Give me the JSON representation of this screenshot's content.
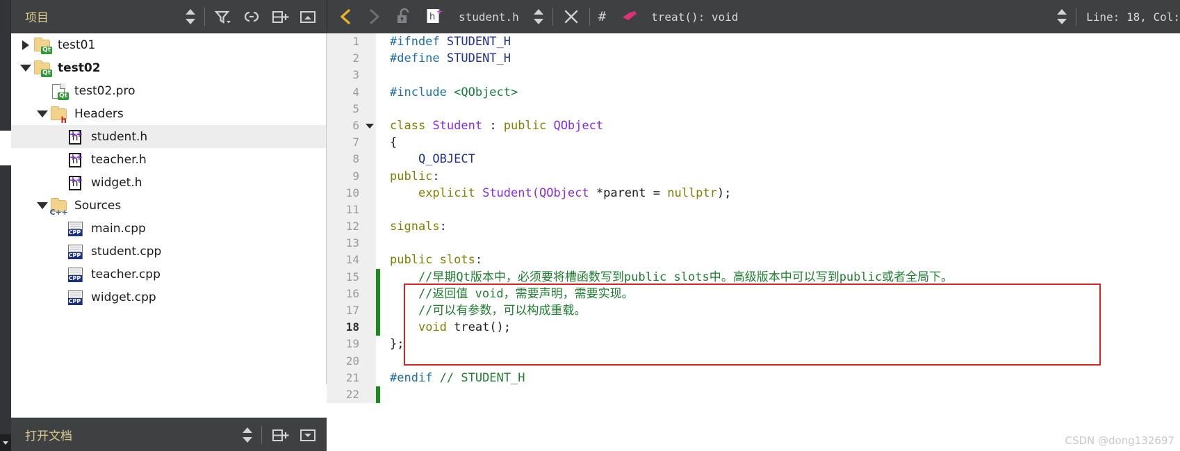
{
  "window": {
    "accent_yellow": "#d9c98a",
    "toolbar_bg": "#3f4042",
    "red_box_color": "#e02020",
    "modified_bar_color": "#1e8a1e"
  },
  "sidebar_header": {
    "title": "项目",
    "icons": [
      "updown-arrows-icon",
      "filter-icon",
      "link-icon",
      "split-add-icon",
      "minimize-pane-icon"
    ]
  },
  "sidebar_footer": {
    "title": "打开文档",
    "icons": [
      "updown-arrows-icon",
      "split-add-icon",
      "close-pane-icon"
    ]
  },
  "editor_toolbar": {
    "back_label": "‹",
    "forward_label": "›",
    "lock_icon": "unlocked-padlock-icon",
    "file_icon": "h-plusplus-file-icon",
    "filename": "student.h",
    "close_label": "✕",
    "hash_label": "#",
    "symbol_icon": "method-icon",
    "symbol": "treat(): void",
    "position": "Line: 18, Col:"
  },
  "tree": [
    {
      "indent": 0,
      "twisty": "right",
      "icon": "qt-folder-icon",
      "label": "test01",
      "bold": false,
      "selected": false
    },
    {
      "indent": 0,
      "twisty": "down",
      "icon": "qt-folder-icon",
      "label": "test02",
      "bold": true,
      "selected": false
    },
    {
      "indent": 1,
      "twisty": "none",
      "icon": "qt-pro-file-icon",
      "label": "test02.pro",
      "bold": false,
      "selected": false
    },
    {
      "indent": 1,
      "twisty": "down",
      "icon": "h-folder-icon",
      "label": "Headers",
      "bold": false,
      "selected": false
    },
    {
      "indent": 2,
      "twisty": "none",
      "icon": "h-plusplus-file-icon",
      "label": "student.h",
      "bold": false,
      "selected": true
    },
    {
      "indent": 2,
      "twisty": "none",
      "icon": "h-plusplus-file-icon",
      "label": "teacher.h",
      "bold": false,
      "selected": false
    },
    {
      "indent": 2,
      "twisty": "none",
      "icon": "h-plusplus-file-icon",
      "label": "widget.h",
      "bold": false,
      "selected": false
    },
    {
      "indent": 1,
      "twisty": "down",
      "icon": "cpp-folder-icon",
      "label": "Sources",
      "bold": false,
      "selected": false
    },
    {
      "indent": 2,
      "twisty": "none",
      "icon": "cpp-file-icon",
      "label": "main.cpp",
      "bold": false,
      "selected": false
    },
    {
      "indent": 2,
      "twisty": "none",
      "icon": "cpp-file-icon",
      "label": "student.cpp",
      "bold": false,
      "selected": false
    },
    {
      "indent": 2,
      "twisty": "none",
      "icon": "cpp-file-icon",
      "label": "teacher.cpp",
      "bold": false,
      "selected": false
    },
    {
      "indent": 2,
      "twisty": "none",
      "icon": "cpp-file-icon",
      "label": "widget.cpp",
      "bold": false,
      "selected": false
    }
  ],
  "code": {
    "current_line": 18,
    "lines": [
      {
        "n": "1",
        "fold": false,
        "mod": false,
        "tokens": [
          {
            "t": "#ifndef ",
            "c": "k-pp"
          },
          {
            "t": "STUDENT_H",
            "c": "k-macro"
          }
        ]
      },
      {
        "n": "2",
        "fold": false,
        "mod": false,
        "tokens": [
          {
            "t": "#define ",
            "c": "k-pp"
          },
          {
            "t": "STUDENT_H",
            "c": "k-macro"
          }
        ]
      },
      {
        "n": "3",
        "fold": false,
        "mod": false,
        "tokens": []
      },
      {
        "n": "4",
        "fold": false,
        "mod": false,
        "tokens": [
          {
            "t": "#include ",
            "c": "k-pp"
          },
          {
            "t": "<QObject>",
            "c": "k-string"
          }
        ]
      },
      {
        "n": "5",
        "fold": false,
        "mod": false,
        "tokens": []
      },
      {
        "n": "6",
        "fold": true,
        "mod": false,
        "tokens": [
          {
            "t": "class ",
            "c": "k-key"
          },
          {
            "t": "Student",
            "c": "k-type"
          },
          {
            "t": " : ",
            "c": "k-punct"
          },
          {
            "t": "public ",
            "c": "k-key"
          },
          {
            "t": "QObject",
            "c": "k-type"
          }
        ]
      },
      {
        "n": "7",
        "fold": false,
        "mod": false,
        "tokens": [
          {
            "t": "{",
            "c": "k-punct"
          }
        ]
      },
      {
        "n": "8",
        "fold": false,
        "mod": false,
        "tokens": [
          {
            "t": "    ",
            "c": "k-punct"
          },
          {
            "t": "Q_OBJECT",
            "c": "k-macro"
          }
        ]
      },
      {
        "n": "9",
        "fold": false,
        "mod": false,
        "tokens": [
          {
            "t": "public",
            "c": "k-key"
          },
          {
            "t": ":",
            "c": "k-colon"
          }
        ]
      },
      {
        "n": "10",
        "fold": false,
        "mod": false,
        "tokens": [
          {
            "t": "    ",
            "c": "k-punct"
          },
          {
            "t": "explicit ",
            "c": "k-key"
          },
          {
            "t": "Student(",
            "c": "k-type"
          },
          {
            "t": "QObject",
            "c": "k-type"
          },
          {
            "t": " *parent = ",
            "c": "k-punct"
          },
          {
            "t": "nullptr",
            "c": "k-key"
          },
          {
            "t": ");",
            "c": "k-punct"
          }
        ]
      },
      {
        "n": "11",
        "fold": false,
        "mod": false,
        "tokens": []
      },
      {
        "n": "12",
        "fold": false,
        "mod": false,
        "tokens": [
          {
            "t": "signals",
            "c": "k-key"
          },
          {
            "t": ":",
            "c": "k-colon"
          }
        ]
      },
      {
        "n": "13",
        "fold": false,
        "mod": false,
        "tokens": []
      },
      {
        "n": "14",
        "fold": false,
        "mod": false,
        "tokens": [
          {
            "t": "public slots",
            "c": "k-key"
          },
          {
            "t": ":",
            "c": "k-colon"
          }
        ]
      },
      {
        "n": "15",
        "fold": false,
        "mod": true,
        "tokens": [
          {
            "t": "    //早期Qt版本中，必须要将槽函数写到public slots中。高级版本中可以写到public或者全局下。",
            "c": "k-comment"
          }
        ]
      },
      {
        "n": "16",
        "fold": false,
        "mod": true,
        "tokens": [
          {
            "t": "    //返回值 void，需要声明，需要实现。",
            "c": "k-comment"
          }
        ]
      },
      {
        "n": "17",
        "fold": false,
        "mod": true,
        "tokens": [
          {
            "t": "    //可以有参数，可以构成重载。",
            "c": "k-comment"
          }
        ]
      },
      {
        "n": "18",
        "fold": false,
        "mod": true,
        "tokens": [
          {
            "t": "    ",
            "c": "k-punct"
          },
          {
            "t": "void ",
            "c": "k-key"
          },
          {
            "t": "treat();",
            "c": "k-punct"
          }
        ]
      },
      {
        "n": "19",
        "fold": false,
        "mod": false,
        "tokens": [
          {
            "t": "};",
            "c": "k-punct"
          }
        ]
      },
      {
        "n": "20",
        "fold": false,
        "mod": false,
        "tokens": []
      },
      {
        "n": "21",
        "fold": false,
        "mod": false,
        "tokens": [
          {
            "t": "#endif ",
            "c": "k-pp"
          },
          {
            "t": "// STUDENT_H",
            "c": "k-comment"
          }
        ]
      },
      {
        "n": "22",
        "fold": false,
        "mod": true,
        "tokens": []
      }
    ]
  },
  "watermark": "CSDN @dong132697"
}
